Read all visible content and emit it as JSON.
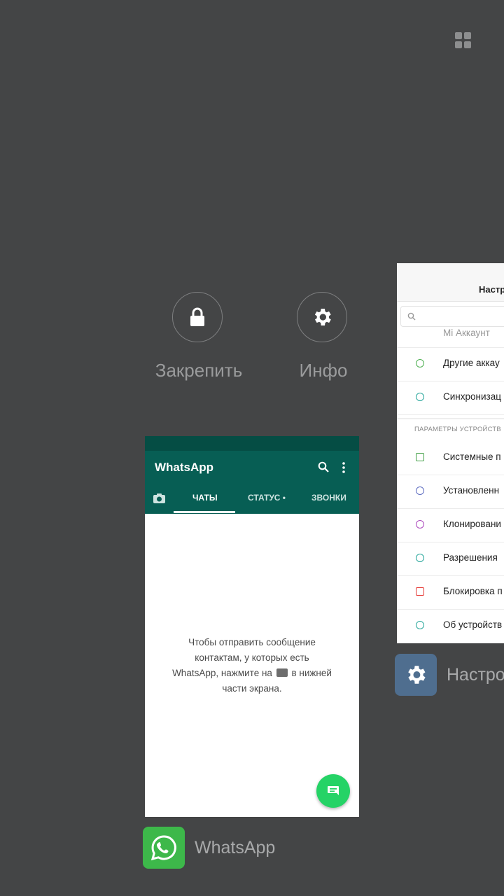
{
  "top_bar": {
    "grid_icon": "grid-view-icon"
  },
  "actions": {
    "lock": {
      "label": "Закрепить",
      "icon": "lock-icon"
    },
    "info": {
      "label": "Инфо",
      "icon": "gear-icon"
    }
  },
  "whatsapp_card": {
    "title": "WhatsApp",
    "tabs": [
      "ЧАТЫ",
      "СТАТУС •",
      "ЗВОНКИ"
    ],
    "empty_line1": "Чтобы отправить сообщение",
    "empty_line2": "контактам, у которых есть",
    "empty_line3a": "WhatsApp, нажмите на",
    "empty_line3b": "в нижней",
    "empty_line4": "части экрана.",
    "app_label": "WhatsApp",
    "colors": {
      "header": "#075e54",
      "fab": "#25d366"
    }
  },
  "settings_card": {
    "title": "Настр",
    "partial_top_item": "Mi Аккаунт",
    "items": [
      {
        "label": "Другие аккау",
        "icon_color": "#4caf50"
      },
      {
        "label": "Синхронизац",
        "icon_color": "#26a69a"
      }
    ],
    "section": "ПАРАМЕТРЫ УСТРОЙСТВ",
    "device_items": [
      {
        "label": "Системные п",
        "icon_color": "#43a047"
      },
      {
        "label": "Установленн",
        "icon_color": "#5c6bc0"
      },
      {
        "label": "Клонировани",
        "icon_color": "#ab47bc"
      },
      {
        "label": "Разрешения",
        "icon_color": "#26a69a"
      },
      {
        "label": "Блокировка п",
        "icon_color": "#e53935"
      },
      {
        "label": "Об устройств",
        "icon_color": "#26a69a"
      }
    ],
    "app_label": "Настро"
  }
}
